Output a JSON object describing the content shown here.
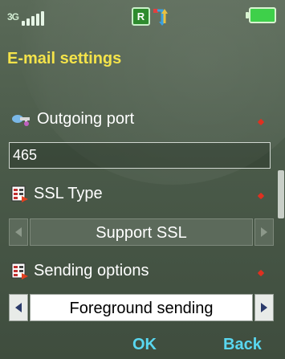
{
  "status_bar": {
    "network_tag": "3G",
    "roaming_badge": "R",
    "icons": [
      "signal-icon",
      "roaming-icon",
      "data-transfer-icon",
      "battery-icon"
    ]
  },
  "title": "E-mail settings",
  "fields": {
    "outgoing_port": {
      "label": "Outgoing port",
      "value": "465",
      "icon": "email-key-icon"
    },
    "ssl_type": {
      "label": "SSL Type",
      "value": "Support SSL",
      "icon": "settings-list-icon"
    },
    "sending_options": {
      "label": "Sending options",
      "value": "Foreground sending",
      "icon": "settings-list-icon"
    }
  },
  "softkeys": {
    "ok": "OK",
    "back": "Back"
  },
  "colors": {
    "title": "#f4e34a",
    "softkey": "#59d7f0",
    "required_marker": "#e03020",
    "background": "#4a5a49"
  }
}
